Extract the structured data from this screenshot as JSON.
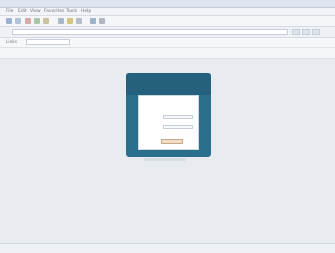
{
  "window": {
    "title": ""
  },
  "menu": {
    "items": [
      "File",
      "Edit",
      "View",
      "Favorites",
      "Tools",
      "Help"
    ]
  },
  "address": {
    "value": ""
  },
  "links": {
    "label": "Links",
    "search_placeholder": ""
  },
  "status": {
    "left": "",
    "right": ""
  },
  "login": {
    "title": "",
    "username_label": "",
    "password_label": "",
    "button_label": ""
  },
  "colors": {
    "window_bg": "#e9ecf1",
    "login_bg": "#2a6f8c",
    "login_card": "#ffffff"
  },
  "icons": [
    "back-icon",
    "forward-icon",
    "stop-icon",
    "refresh-icon",
    "home-icon",
    "search-icon",
    "favorites-icon",
    "history-icon",
    "mail-icon",
    "print-icon"
  ]
}
